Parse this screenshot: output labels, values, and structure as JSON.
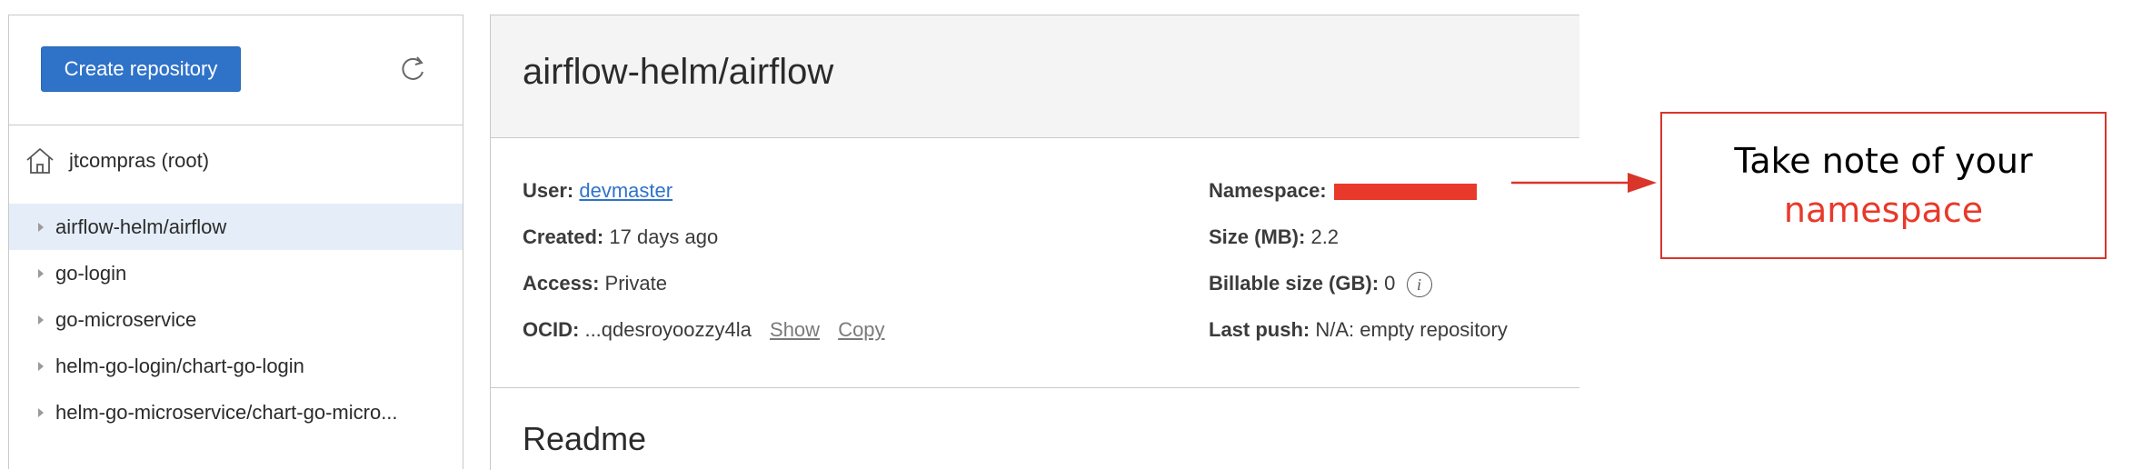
{
  "sidebar": {
    "create_button": "Create repository",
    "root_label": "jtcompras (root)",
    "items": [
      {
        "label": "airflow-helm/airflow",
        "selected": true
      },
      {
        "label": "go-login"
      },
      {
        "label": "go-microservice"
      },
      {
        "label": "helm-go-login/chart-go-login"
      },
      {
        "label": "helm-go-microservice/chart-go-micro..."
      }
    ]
  },
  "main": {
    "title": "airflow-helm/airflow",
    "user_label": "User:",
    "user_value": "devmaster",
    "created_label": "Created:",
    "created_value": "17 days ago",
    "access_label": "Access:",
    "access_value": "Private",
    "ocid_label": "OCID:",
    "ocid_value": "...qdesroyoozzy4la",
    "show_link": "Show",
    "copy_link": "Copy",
    "namespace_label": "Namespace:",
    "size_label": "Size (MB):",
    "size_value": "2.2",
    "billable_label": "Billable size (GB):",
    "billable_value": "0",
    "last_push_label": "Last push:",
    "last_push_value": "N/A: empty repository",
    "readme_heading": "Readme"
  },
  "annotation": {
    "line1": "Take note of your",
    "line2": "namespace"
  },
  "colors": {
    "accent": "#2f73c9",
    "annotation_red": "#e8392a",
    "selected_bg": "#e5eef8"
  }
}
